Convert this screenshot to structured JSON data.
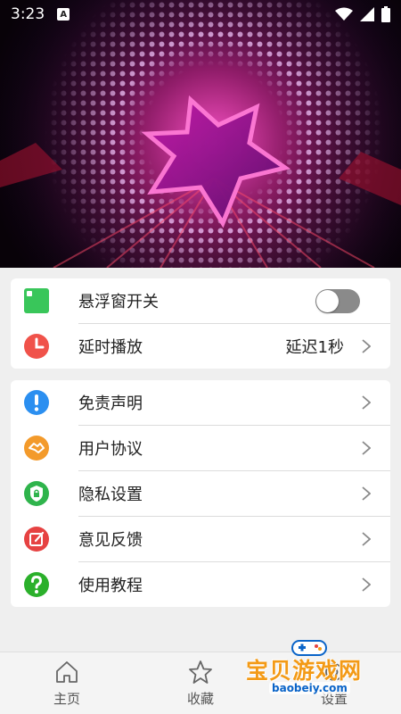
{
  "status": {
    "time": "3:23",
    "badge": "A"
  },
  "settings_group_1": {
    "items": [
      {
        "label": "悬浮窗开关",
        "icon": "square-icon",
        "color": "#39c65a"
      },
      {
        "label": "延时播放",
        "value": "延迟1秒",
        "icon": "clock-icon",
        "color": "#f0524a"
      }
    ],
    "floating_window_enabled": false
  },
  "settings_group_2": {
    "items": [
      {
        "label": "免责声明",
        "icon": "exclamation-icon",
        "color": "#2b8ff0"
      },
      {
        "label": "用户协议",
        "icon": "handshake-icon",
        "color": "#f39a2b"
      },
      {
        "label": "隐私设置",
        "icon": "shield-lock-icon",
        "color": "#2fb44c"
      },
      {
        "label": "意见反馈",
        "icon": "edit-icon",
        "color": "#e64242"
      },
      {
        "label": "使用教程",
        "icon": "question-icon",
        "color": "#2bb02b"
      }
    ]
  },
  "tabbar": {
    "tabs": [
      {
        "label": "主页",
        "icon": "home-icon"
      },
      {
        "label": "收藏",
        "icon": "star-icon"
      },
      {
        "label": "设置",
        "icon": "settings-icon"
      }
    ]
  },
  "watermark": {
    "title": "宝贝游戏网",
    "url": "baobeiy.com"
  }
}
